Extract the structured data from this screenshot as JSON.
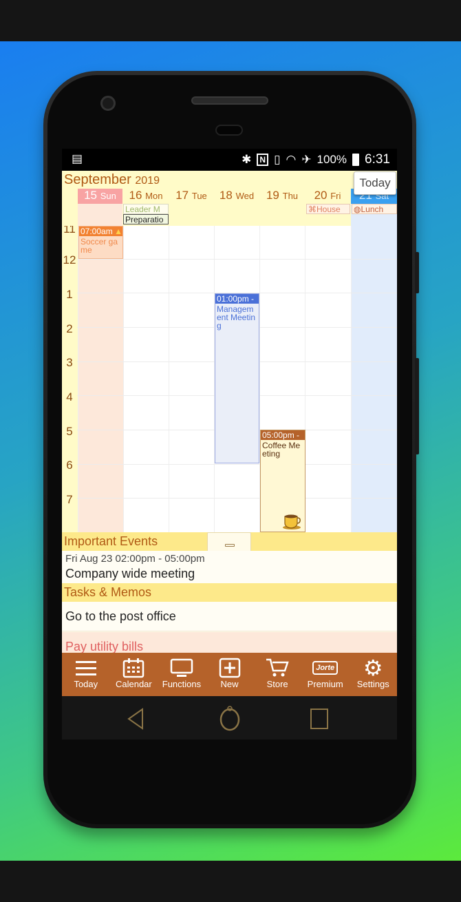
{
  "status": {
    "battery": "100%",
    "time": "6:31"
  },
  "header": {
    "month": "September",
    "year": "2019",
    "today_button": "Today"
  },
  "days": [
    {
      "num": "15",
      "name": "Sun"
    },
    {
      "num": "16",
      "name": "Mon"
    },
    {
      "num": "17",
      "name": "Tue"
    },
    {
      "num": "18",
      "name": "Wed"
    },
    {
      "num": "19",
      "name": "Thu"
    },
    {
      "num": "20",
      "name": "Fri"
    },
    {
      "num": "21",
      "name": "Sat"
    }
  ],
  "allday_events": {
    "leader": "Leader M",
    "preparation": "Preparatio",
    "house": "House",
    "lunch": "Lunch"
  },
  "hours": [
    "11",
    "12",
    "1",
    "2",
    "3",
    "4",
    "5",
    "6",
    "7"
  ],
  "events": {
    "soccer": {
      "time": "07:00am",
      "name": "Soccer ga me"
    },
    "management": {
      "time": "01:00pm -",
      "name": "Managem ent Meetin g"
    },
    "coffee": {
      "time": "05:00pm -",
      "name": "Coffee Me eting"
    }
  },
  "important": {
    "header": "Important Events",
    "item_time": "Fri Aug 23 02:00pm - 05:00pm",
    "item_title": "Company wide meeting"
  },
  "tasks": {
    "header": "Tasks & Memos",
    "items": [
      "Go to the post office",
      "Pay utility bills"
    ]
  },
  "bottom_nav": [
    "Today",
    "Calendar",
    "Functions",
    "New",
    "Store",
    "Premium",
    "Settings"
  ],
  "premium_logo": "Jorte",
  "colors": {
    "accent": "#b5622a",
    "header_bg": "#fffbc8",
    "section_bg": "#fde98a"
  }
}
